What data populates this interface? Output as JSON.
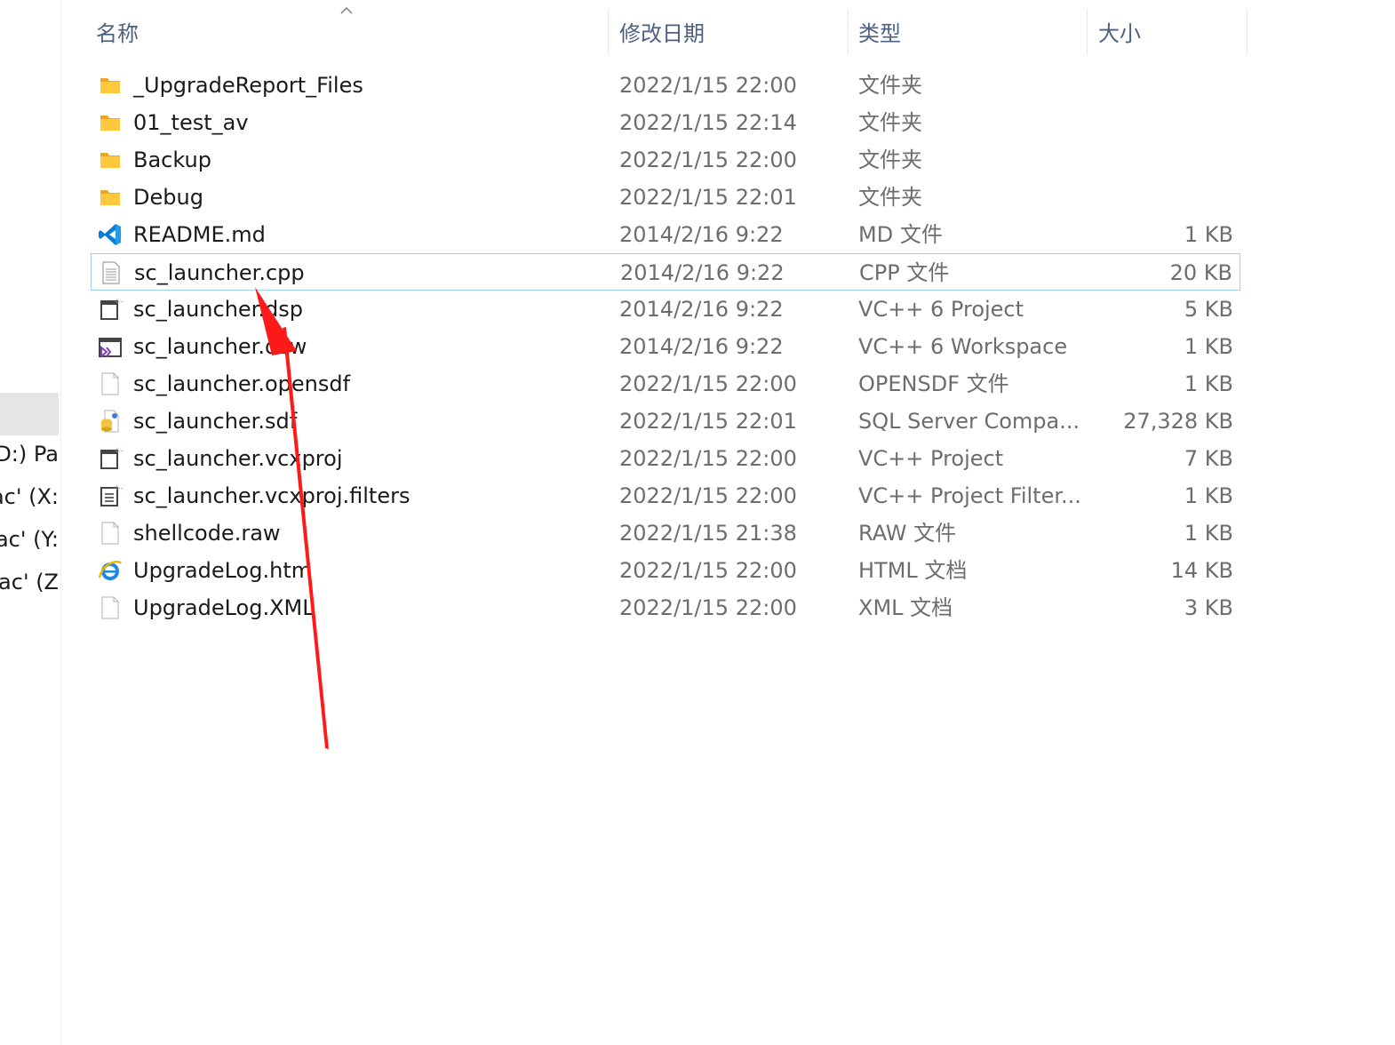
{
  "nav": {
    "items": [
      "D:) Pa",
      "ac' (X:",
      "ac' (Y:",
      "lac' (Z"
    ]
  },
  "columns": {
    "name": "名称",
    "modified": "修改日期",
    "type": "类型",
    "size": "大小"
  },
  "files": [
    {
      "name": "_UpgradeReport_Files",
      "modified": "2022/1/15 22:00",
      "type": "文件夹",
      "size": "",
      "icon": "folder-icon"
    },
    {
      "name": "01_test_av",
      "modified": "2022/1/15 22:14",
      "type": "文件夹",
      "size": "",
      "icon": "folder-icon"
    },
    {
      "name": "Backup",
      "modified": "2022/1/15 22:00",
      "type": "文件夹",
      "size": "",
      "icon": "folder-icon"
    },
    {
      "name": "Debug",
      "modified": "2022/1/15 22:01",
      "type": "文件夹",
      "size": "",
      "icon": "folder-icon"
    },
    {
      "name": "README.md",
      "modified": "2014/2/16 9:22",
      "type": "MD 文件",
      "size": "1 KB",
      "icon": "vscode-icon"
    },
    {
      "name": "sc_launcher.cpp",
      "modified": "2014/2/16 9:22",
      "type": "CPP 文件",
      "size": "20 KB",
      "icon": "text-file-icon"
    },
    {
      "name": "sc_launcher.dsp",
      "modified": "2014/2/16 9:22",
      "type": "VC++ 6 Project",
      "size": "5 KB",
      "icon": "vc-project-icon"
    },
    {
      "name": "sc_launcher.dsw",
      "modified": "2014/2/16 9:22",
      "type": "VC++ 6 Workspace",
      "size": "1 KB",
      "icon": "vs-workspace-icon"
    },
    {
      "name": "sc_launcher.opensdf",
      "modified": "2022/1/15 22:00",
      "type": "OPENSDF 文件",
      "size": "1 KB",
      "icon": "blank-file-icon"
    },
    {
      "name": "sc_launcher.sdf",
      "modified": "2022/1/15 22:01",
      "type": "SQL Server Compa...",
      "size": "27,328 KB",
      "icon": "sql-database-icon"
    },
    {
      "name": "sc_launcher.vcxproj",
      "modified": "2022/1/15 22:00",
      "type": "VC++ Project",
      "size": "7 KB",
      "icon": "vc-project-icon"
    },
    {
      "name": "sc_launcher.vcxproj.filters",
      "modified": "2022/1/15 22:00",
      "type": "VC++ Project Filter...",
      "size": "1 KB",
      "icon": "vc-filters-icon"
    },
    {
      "name": "shellcode.raw",
      "modified": "2022/1/15 21:38",
      "type": "RAW 文件",
      "size": "1 KB",
      "icon": "blank-file-icon"
    },
    {
      "name": "UpgradeLog.htm",
      "modified": "2022/1/15 22:00",
      "type": "HTML 文档",
      "size": "14 KB",
      "icon": "ie-html-icon"
    },
    {
      "name": "UpgradeLog.XML",
      "modified": "2022/1/15 22:00",
      "type": "XML 文档",
      "size": "3 KB",
      "icon": "blank-file-icon"
    }
  ],
  "selected_file": "sc_launcher.cpp",
  "colors": {
    "header_text": "#4d6082",
    "selection_border": "#99d1ea",
    "arrow": "#ff1a1a",
    "folder": "#ffc83d"
  }
}
